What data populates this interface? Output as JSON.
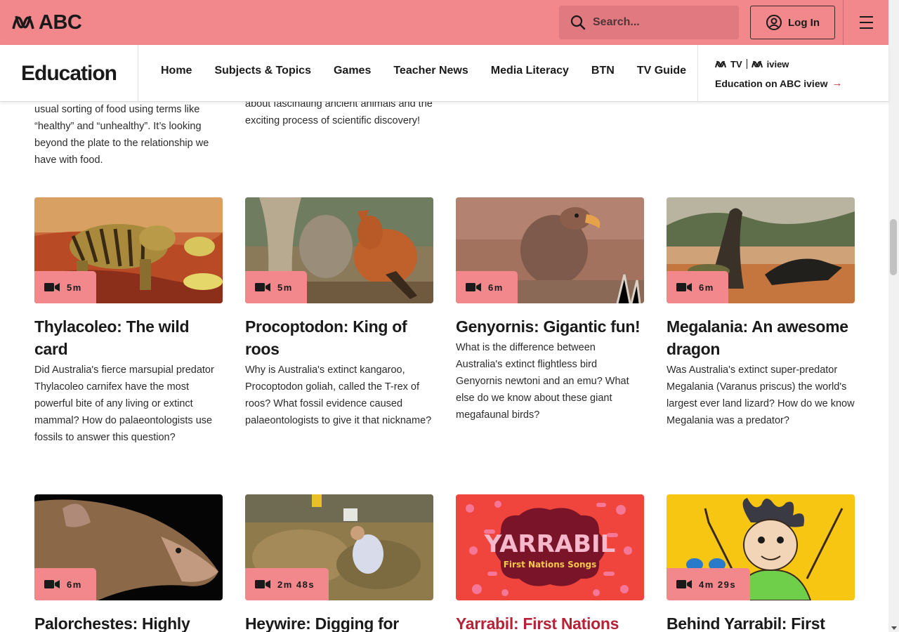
{
  "header": {
    "logo_text": "ABC",
    "search_placeholder": "Search...",
    "login_label": "Log In"
  },
  "section_nav": {
    "brand": "Education",
    "links": [
      "Home",
      "Subjects & Topics",
      "Games",
      "Teacher News",
      "Media Literacy",
      "BTN",
      "TV Guide"
    ],
    "iview_logo_tv": "TV",
    "iview_logo_iview": "iview",
    "iview_link": "Education on ABC iview"
  },
  "top_descriptions": [
    "usual sorting of food using terms like “healthy” and “unhealthy”. It’s looking beyond the plate to the relationship we have with food.",
    "about fascinating ancient animals and the exciting process of scientific discovery!"
  ],
  "cards_row1": [
    {
      "duration": "5m",
      "title": "Thylacoleo: The wild card",
      "description": "Did Australia's fierce marsupial predator Thylacoleo carnifex have the most powerful bite of any living or extinct mammal? How do palaeontologists use fossils to answer this question?"
    },
    {
      "duration": "5m",
      "title": "Procoptodon: King of roos",
      "description": "Why is Australia's extinct kangaroo, Procoptodon goliah, called the T-rex of roos? What fossil evidence caused palaeontologists to give it that nickname?"
    },
    {
      "duration": "6m",
      "title": "Genyornis: Gigantic fun!",
      "description": "What is the difference between Australia's extinct flightless bird Genyornis newtoni and an emu? What else do we know about these giant megafaunal birds?"
    },
    {
      "duration": "6m",
      "title": "Megalania: An awesome dragon",
      "description": "Was Australia's extinct super-predator Megalania (Varanus priscus) the world's largest ever land lizard? How do we know Megalania was a predator?"
    }
  ],
  "cards_row2": [
    {
      "duration": "6m",
      "title": "Palorchestes: Highly"
    },
    {
      "duration": "2m 48s",
      "title": "Heywire: Digging for"
    },
    {
      "duration": "",
      "title": "Yarrabil: First Nations",
      "thumb_text_1": "YARRABIL",
      "thumb_text_2": "First Nations Songs"
    },
    {
      "duration": "4m 29s",
      "title": "Behind Yarrabil: First"
    }
  ],
  "colors": {
    "brand": "#f2878c",
    "active_title": "#b82238",
    "link_arrow": "#c8283c"
  }
}
